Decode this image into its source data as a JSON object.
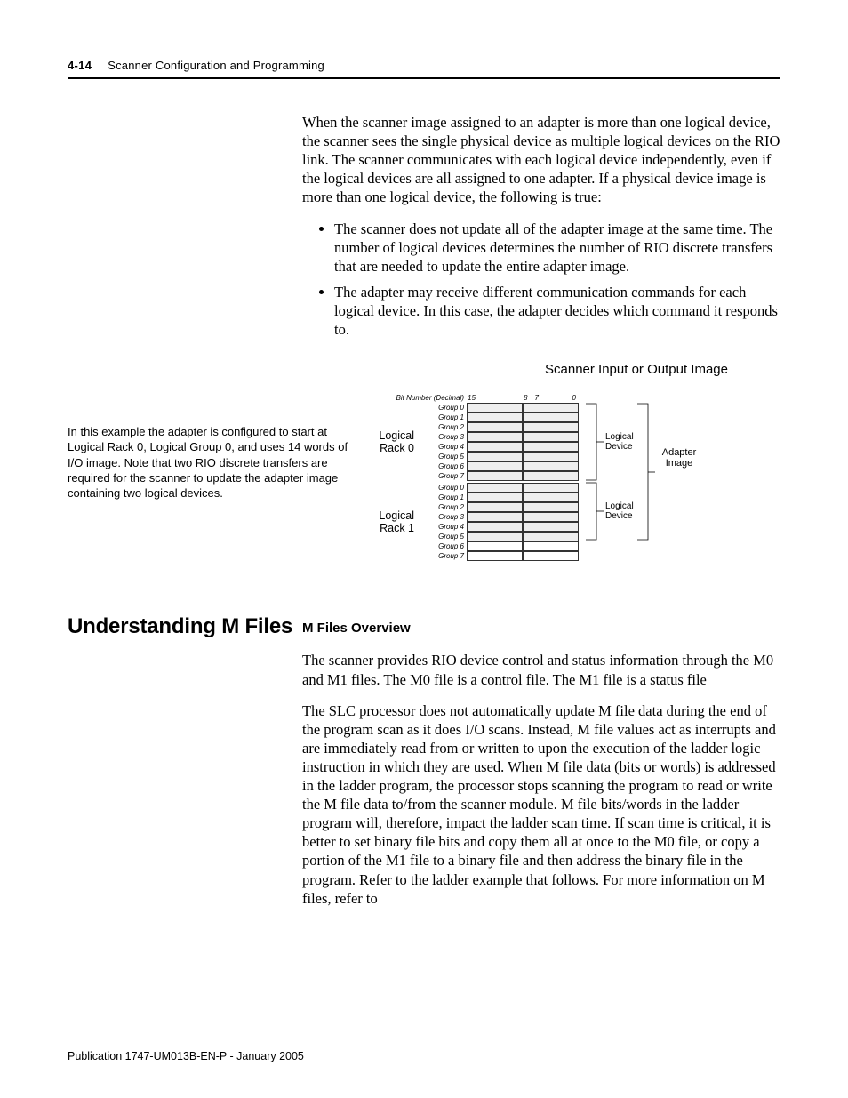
{
  "header": {
    "page_number": "4-14",
    "chapter_title": "Scanner Configuration and Programming"
  },
  "body": {
    "para1": "When the scanner image assigned to an adapter is more than one logical device, the scanner sees the single physical device as multiple logical devices on the RIO link. The scanner communicates with each logical device independently, even if the logical devices are all assigned to one adapter. If a physical device image is more than one logical device, the following is true:",
    "bullet1": "The scanner does not update all of the adapter image at the same time. The number of logical devices determines the number of RIO discrete transfers that are needed to update the entire adapter image.",
    "bullet2": "The adapter may receive different communication commands for each logical device. In this case, the adapter decides which command it responds to."
  },
  "diagram": {
    "title": "Scanner Input or Output Image",
    "side_note": "In this example the adapter is configured to start at Logical Rack 0, Logical Group 0, and uses 14 words of I/O image. Note that two RIO discrete transfers are required for the scanner to update the adapter image containing two logical devices.",
    "bit_number_label": "Bit Number (Decimal)",
    "bits": {
      "b15": "15",
      "b8": "8",
      "b7": "7",
      "b0": "0"
    },
    "rack0": "Logical Rack 0",
    "rack1": "Logical Rack 1",
    "groups": [
      "Group 0",
      "Group 1",
      "Group 2",
      "Group 3",
      "Group 4",
      "Group 5",
      "Group 6",
      "Group 7"
    ],
    "logical_device": "Logical Device",
    "adapter_image": "Adapter Image"
  },
  "section": {
    "heading": "Understanding M Files",
    "sub_heading": "M Files Overview",
    "para1": "The scanner provides RIO device control and status information through the M0 and M1 files. The M0 file is a control file. The M1 file is a status file",
    "para2": "The SLC processor does not automatically update M file data during the end of the program scan as it does I/O scans. Instead, M file values act as interrupts and are immediately read from or written to upon the execution of the ladder logic instruction in which they are used. When M file data (bits or words) is addressed in the ladder program, the processor stops scanning the program to read or write the M file data to/from the scanner module. M file bits/words in the ladder program will, therefore, impact the ladder scan time. If scan time is critical, it is better to set binary file bits and copy them all at once to the M0 file, or copy a portion of the M1 file to a binary file and then address the binary file in the program. Refer to the ladder example that follows. For more information on M files, refer to"
  },
  "footer": {
    "pub": "Publication 1747-UM013B-EN-P - January 2005"
  }
}
